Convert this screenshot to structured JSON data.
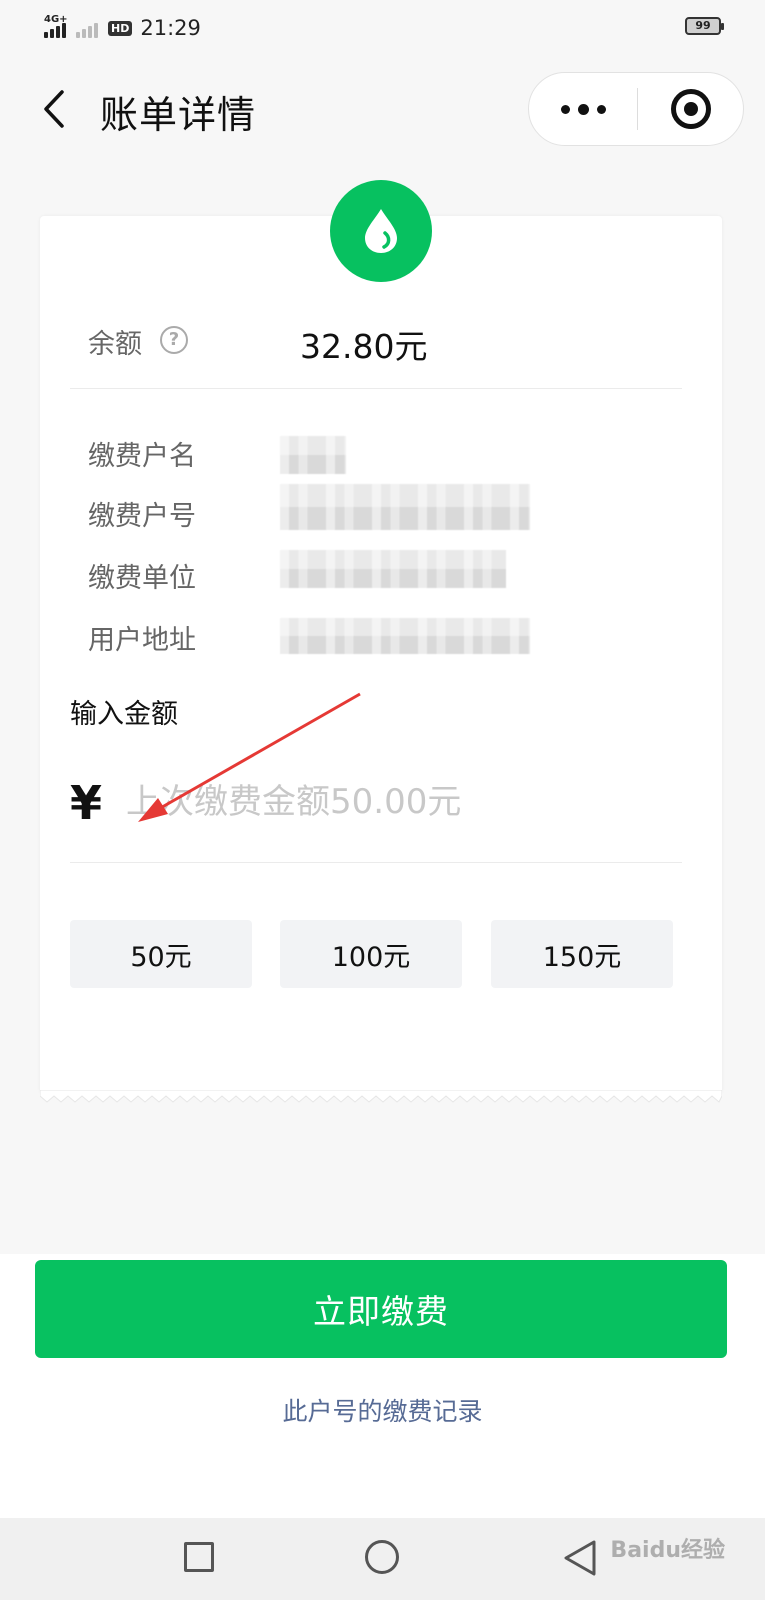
{
  "status_bar": {
    "network": "4G+",
    "hd": "HD",
    "time": "21:29",
    "battery": "99"
  },
  "nav": {
    "title": "账单详情"
  },
  "bill": {
    "balance_label": "余额",
    "help": "?",
    "balance_value": "32.80元",
    "fields": [
      "缴费户名",
      "缴费户号",
      "缴费单位",
      "用户地址"
    ],
    "amount_section_title": "输入金额",
    "currency_symbol": "¥",
    "amount_placeholder": "上次缴费金额50.00元",
    "presets": [
      "50元",
      "100元",
      "150元"
    ]
  },
  "actions": {
    "pay_label": "立即缴费",
    "record_link": "此户号的缴费记录"
  },
  "watermark": "Baidu经验",
  "colors": {
    "brand_green": "#07c160",
    "link_blue": "#576b95",
    "annotation_red": "#e53935"
  }
}
